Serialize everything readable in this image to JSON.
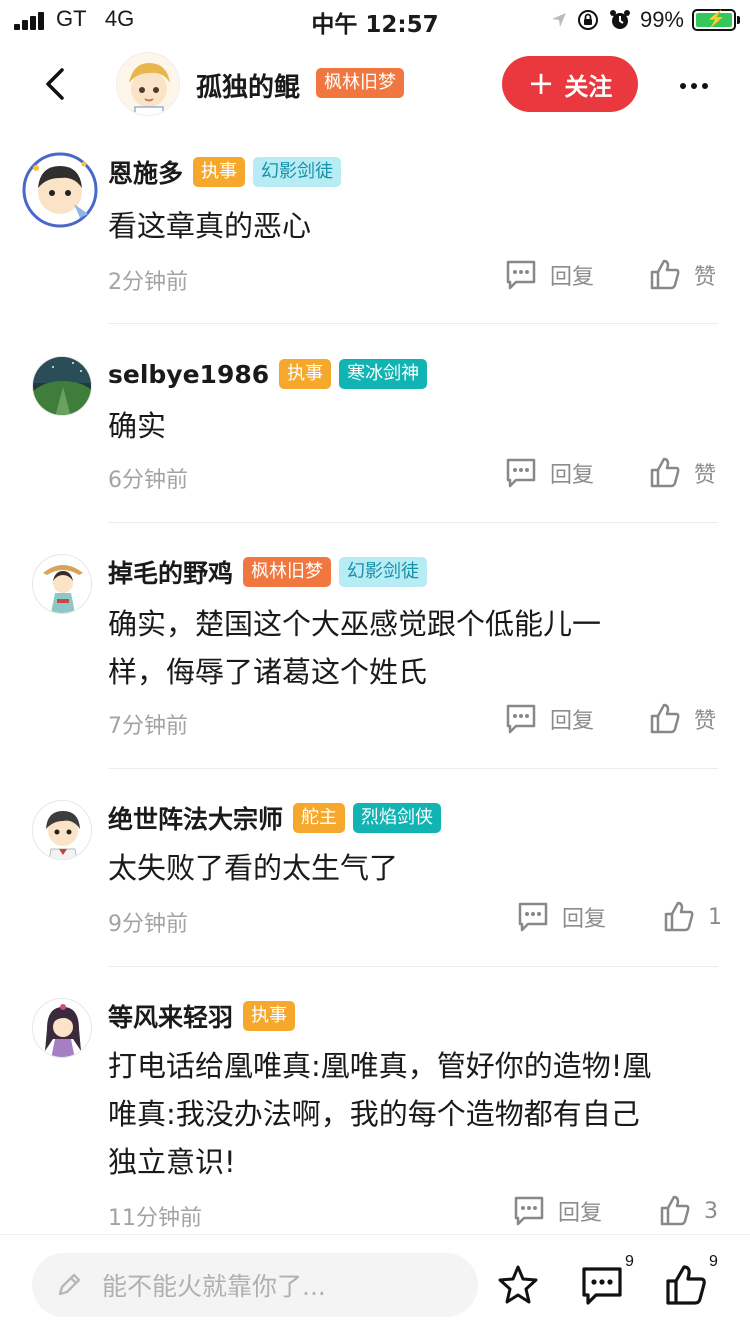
{
  "status_bar": {
    "carrier": "GT",
    "network": "4G",
    "time": "中午 12:57",
    "battery_percent": "99%",
    "battery_color": "#34c759"
  },
  "header": {
    "back_icon": "chevron-left-icon",
    "author_name": "孤独的鲲",
    "author_badge": "枫林旧梦",
    "follow_label": "关注",
    "more_icon": "more-dots-icon"
  },
  "comments": [
    {
      "name": "恩施多",
      "badges": [
        {
          "text": "执事",
          "style": "yellow"
        },
        {
          "text": "幻影剑徒",
          "style": "lightblue"
        }
      ],
      "text_lines": [
        "看这章真的恶心"
      ],
      "time": "2分钟前",
      "reply_label": "回复",
      "like_label": "赞"
    },
    {
      "name": "selbye1986",
      "badges": [
        {
          "text": "执事",
          "style": "yellow"
        },
        {
          "text": "寒冰剑神",
          "style": "teal"
        }
      ],
      "text_lines": [
        "确实"
      ],
      "time": "6分钟前",
      "reply_label": "回复",
      "like_label": "赞"
    },
    {
      "name": "掉毛的野鸡",
      "badges": [
        {
          "text": "枫林旧梦",
          "style": "orange"
        },
        {
          "text": "幻影剑徒",
          "style": "lightblue"
        }
      ],
      "text_lines": [
        "确实，楚国这个大巫感觉跟个低能儿一",
        "样，侮辱了诸葛这个姓氏"
      ],
      "time": "7分钟前",
      "reply_label": "回复",
      "like_label": "赞"
    },
    {
      "name": "绝世阵法大宗师",
      "badges": [
        {
          "text": "舵主",
          "style": "yellow"
        },
        {
          "text": "烈焰剑侠",
          "style": "teal"
        }
      ],
      "text_lines": [
        "太失败了看的太生气了"
      ],
      "time": "9分钟前",
      "reply_label": "回复",
      "like_label": "1"
    },
    {
      "name": "等风来轻羽",
      "badges": [
        {
          "text": "执事",
          "style": "yellow"
        }
      ],
      "text_lines": [
        "打电话给凰唯真:凰唯真，管好你的造物!凰",
        "唯真:我没办法啊，我的每个造物都有自己",
        "独立意识!"
      ],
      "time": "11分钟前",
      "reply_label": "回复",
      "like_label": "3"
    }
  ],
  "bottom_bar": {
    "input_placeholder": "能不能火就靠你了...",
    "comment_count": "9",
    "like_count": "9"
  },
  "colors": {
    "follow_button": "#e9393f",
    "badge_orange": "#f0773f",
    "badge_yellow": "#f6a82d",
    "badge_lightblue": "#b7ecf4",
    "badge_teal": "#12b3b3"
  }
}
